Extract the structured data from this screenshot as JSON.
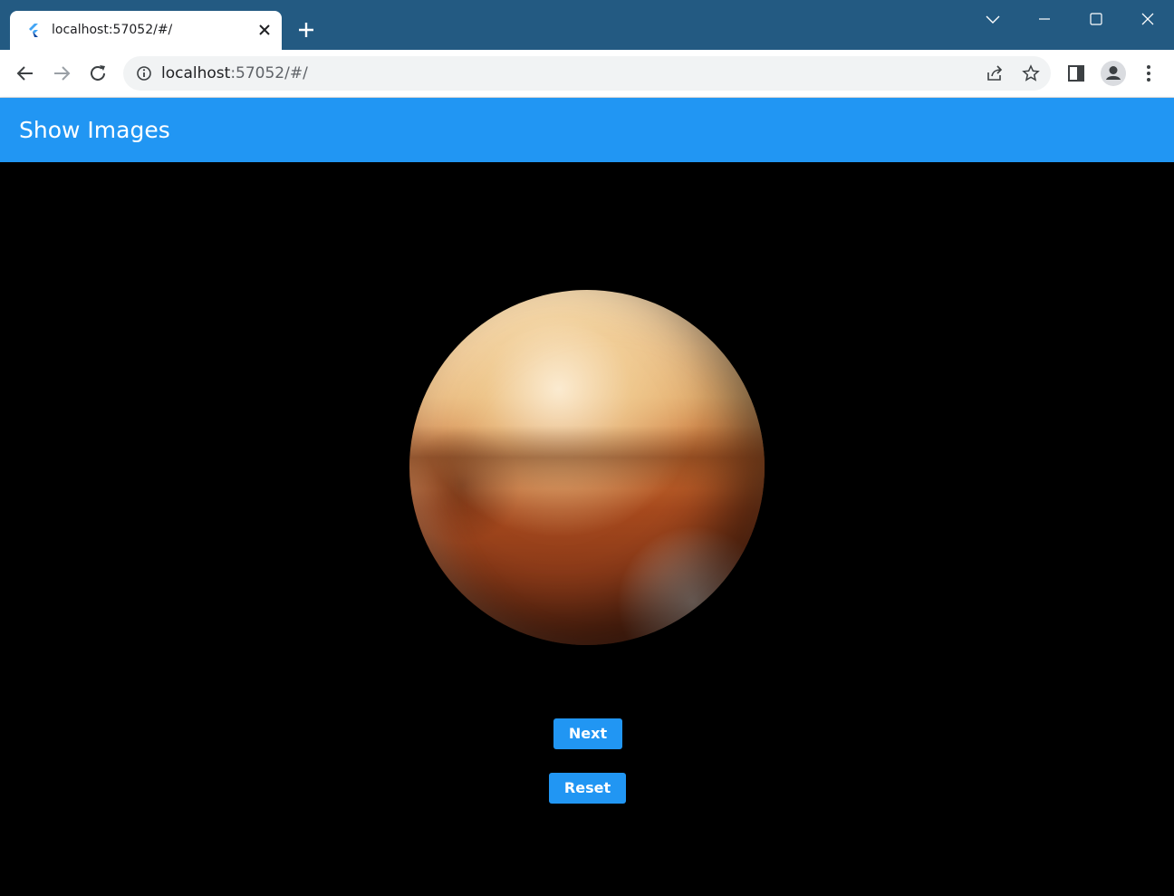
{
  "browser": {
    "tab_title": "localhost:57052/#/",
    "url_host": "localhost",
    "url_rest": ":57052/#/",
    "icons": [
      "flutter-favicon",
      "close-icon",
      "plus-icon",
      "chevron-down-icon",
      "minimize-icon",
      "maximize-icon",
      "close-window-icon",
      "back-icon",
      "forward-icon",
      "reload-icon",
      "info-icon",
      "share-icon",
      "star-icon",
      "side-panel-icon",
      "profile-icon",
      "kebab-menu-icon"
    ]
  },
  "app": {
    "title": "Show Images",
    "accent": "#2196f3",
    "background": "#000000"
  },
  "buttons": {
    "next_label": "Next",
    "reset_label": "Reset"
  }
}
